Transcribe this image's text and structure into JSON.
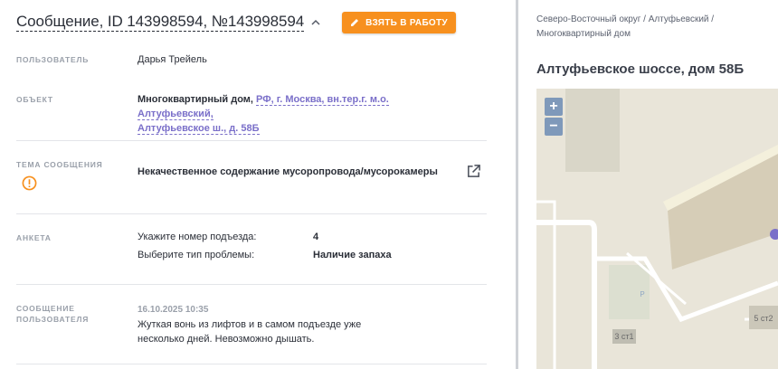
{
  "message": {
    "title": "Сообщение, ID 143998594, №143998594",
    "take_button": "ВЗЯТЬ В РАБОТУ"
  },
  "user": {
    "label": "ПОЛЬЗОВАТЕЛЬ",
    "name": "Дарья Трейель"
  },
  "object": {
    "label": "ОБЪЕКТ",
    "type": "Многоквартирный дом,",
    "address_line1": "РФ, г. Москва, вн.тер.г. м.о. Алтуфьевский,",
    "address_line2": "Алтуфьевское ш., д. 58Б"
  },
  "topic": {
    "label": "ТЕМА СООБЩЕНИЯ",
    "value": "Некачественное содержание мусоропровода/мусорокамеры"
  },
  "anketa": {
    "label": "АНКЕТА",
    "rows": [
      {
        "question": "Укажите номер подъезда:",
        "answer": "4"
      },
      {
        "question": "Выберите тип проблемы:",
        "answer": "Наличие запаха"
      }
    ]
  },
  "user_message": {
    "label_line1": "СООБЩЕНИЕ",
    "label_line2": "ПОЛЬЗОВАТЕЛЯ",
    "date": "16.10.2025 10:35",
    "text": "Жуткая вонь из лифтов и в самом подъезде уже несколько дней. Невозможно дышать."
  },
  "location": {
    "breadcrumb_line1": "Северо-Восточный округ / Алтуфьевский /",
    "breadcrumb_line2": "Многоквартирный дом",
    "title": "Алтуфьевское шоссе, дом 58Б"
  },
  "map": {
    "zoom_in": "+",
    "zoom_out": "−",
    "label_building_1": "3 ст1",
    "label_building_2": "5 ст2",
    "parking": "P",
    "accent_color": "#7a6fc9"
  },
  "colors": {
    "primary_button": "#f7901e",
    "link": "#7a6fc9",
    "warning": "#f7901e"
  }
}
